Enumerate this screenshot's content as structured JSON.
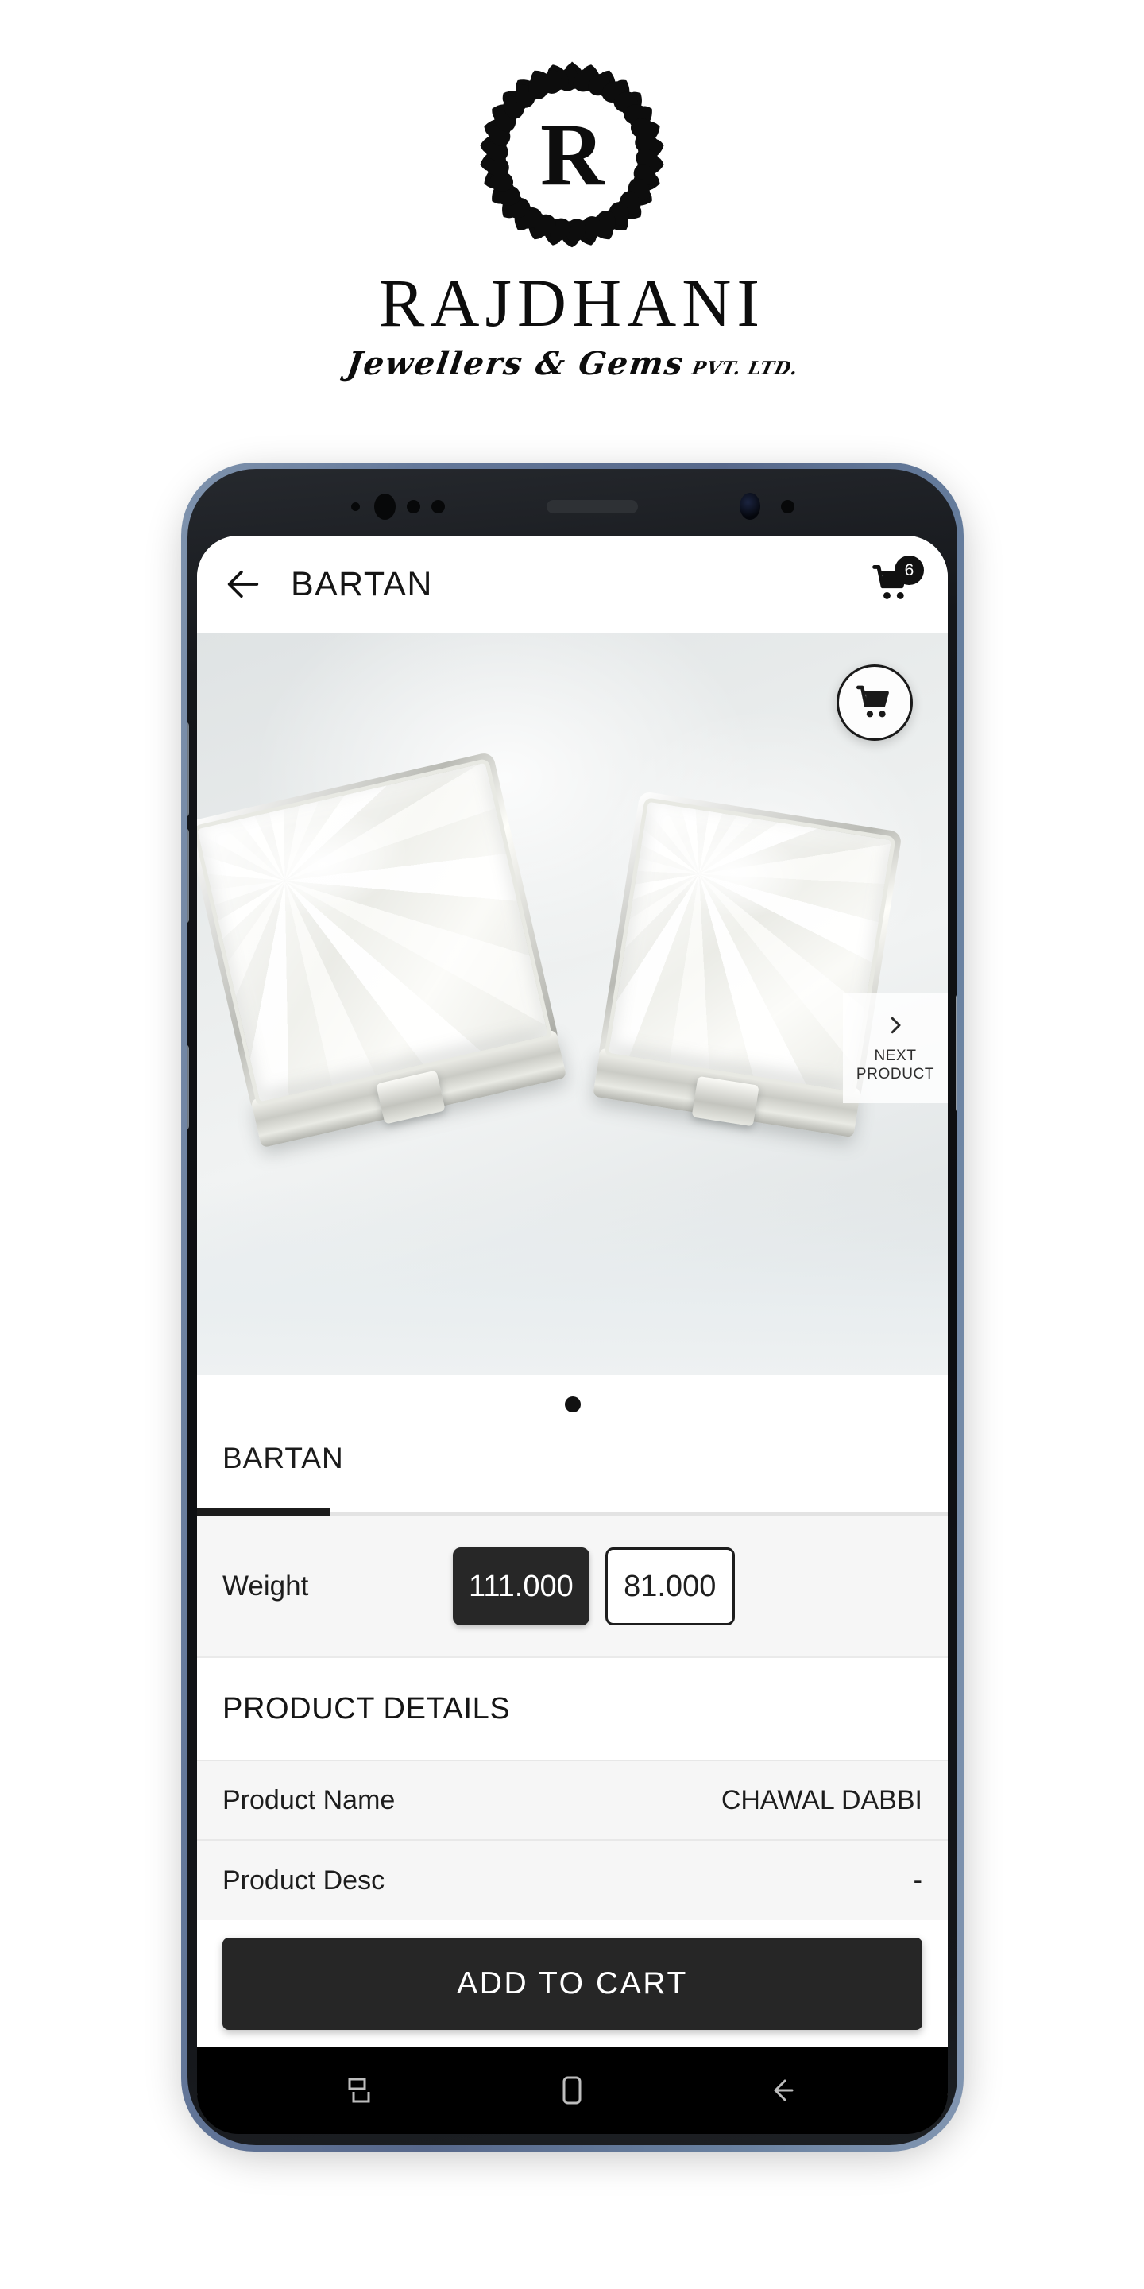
{
  "brand": {
    "monogram": "R",
    "name": "RAJDHANI",
    "tagline_main": "Jewellers & Gems",
    "tagline_suffix": "PVT. LTD."
  },
  "appbar": {
    "back_icon": "arrow-left-icon",
    "title": "BARTAN",
    "cart_icon": "shopping-cart-icon",
    "cart_count": "6"
  },
  "hero": {
    "fab_cart_icon": "shopping-cart-icon",
    "next_product": {
      "icon": "chevron-right-icon",
      "line1": "NEXT",
      "line2": "PRODUCT"
    },
    "page_dots": 1
  },
  "tabs": [
    {
      "label": "BARTAN",
      "active": true
    }
  ],
  "weight": {
    "label": "Weight",
    "options": [
      {
        "value": "111.000",
        "selected": true
      },
      {
        "value": "81.000",
        "selected": false
      }
    ]
  },
  "product_details": {
    "header": "PRODUCT DETAILS",
    "rows": [
      {
        "key": "Product Name",
        "value": "CHAWAL DABBI"
      },
      {
        "key": "Product Desc",
        "value": "-"
      }
    ]
  },
  "cta": {
    "label": "ADD TO CART"
  },
  "android_nav": {
    "recents_icon": "recents-icon",
    "home_icon": "home-icon",
    "back_icon": "back-icon"
  },
  "colors": {
    "accent_dark": "#262626",
    "badge": "#111111",
    "panel": "#f6f6f6",
    "frame": "#64789a"
  }
}
